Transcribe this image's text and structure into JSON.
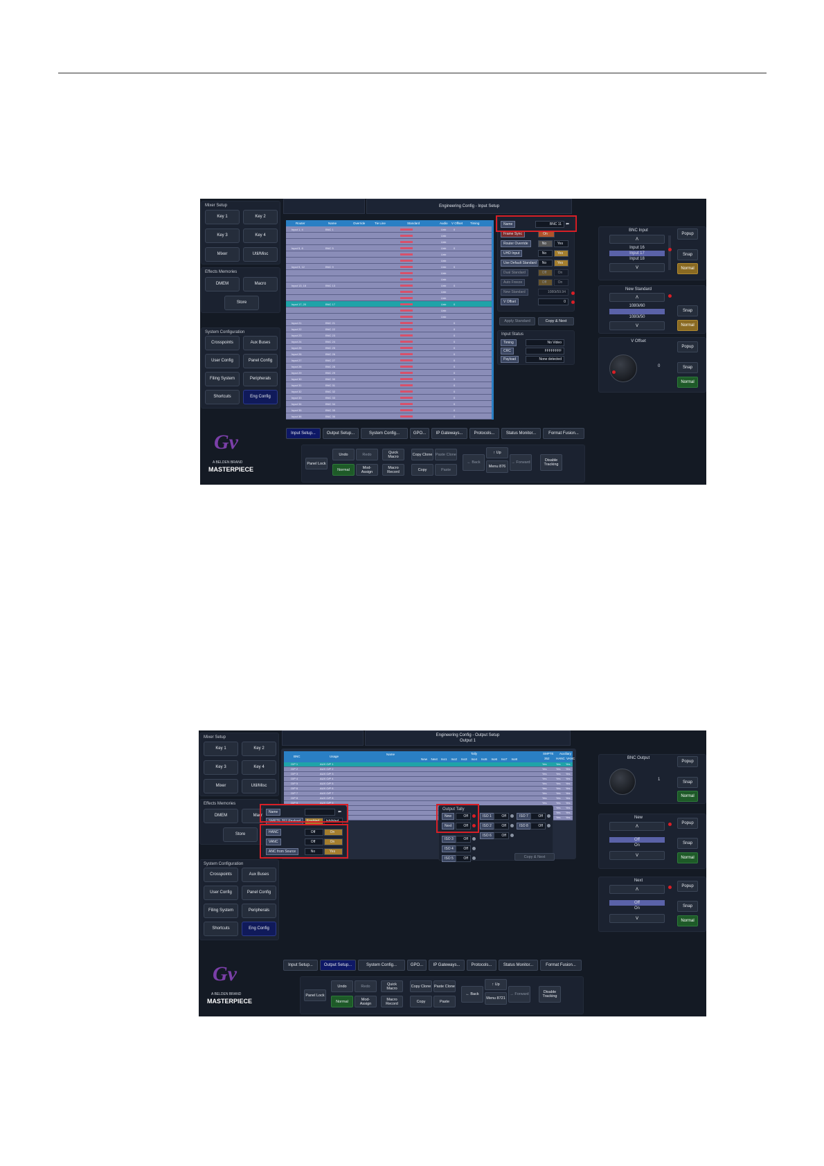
{
  "shot1": {
    "title": "Engineering Config - Input Setup",
    "mixer_setup": {
      "label": "Mixer Setup",
      "buttons": [
        "Key 1",
        "Key 2",
        "Key 3",
        "Key 4",
        "Mixer",
        "Util/Misc"
      ]
    },
    "effects_memories": {
      "label": "Effects Memories",
      "buttons": [
        "DMEM",
        "Macro",
        "Store"
      ]
    },
    "system_config": {
      "label": "System Configuration",
      "buttons": [
        "Crosspoints",
        "Aux Buses",
        "User Config",
        "Panel Config",
        "Filing System",
        "Peripherals",
        "Shortcuts",
        "Eng Config"
      ]
    },
    "brand": {
      "sub": "A BELDEN BRAND",
      "product": "MASTERPIECE"
    },
    "table_headers": [
      "Router",
      "Name",
      "Override",
      "Tie Line",
      "Standard",
      "Audio",
      "V Offset",
      "Timing"
    ],
    "rows": [
      {
        "router": "Input 1, 4",
        "name": "BNC 1",
        "std": "",
        "audio": "Unb",
        "off": "0"
      },
      {
        "router": "",
        "name": "",
        "std": "",
        "audio": "Unb",
        "off": ""
      },
      {
        "router": "",
        "name": "",
        "std": "",
        "audio": "Unb",
        "off": ""
      },
      {
        "router": "Input 5, 8",
        "name": "BNC 5",
        "std": "",
        "audio": "Unb",
        "off": "0"
      },
      {
        "router": "",
        "name": "",
        "std": "",
        "audio": "Unb",
        "off": ""
      },
      {
        "router": "",
        "name": "",
        "std": "",
        "audio": "Unb",
        "off": ""
      },
      {
        "router": "Input 9, 12",
        "name": "BNC 9",
        "std": "",
        "audio": "Unb",
        "off": "0"
      },
      {
        "router": "",
        "name": "",
        "std": "",
        "audio": "Unb",
        "off": ""
      },
      {
        "router": "",
        "name": "",
        "std": "",
        "audio": "Unb",
        "off": ""
      },
      {
        "router": "Input 13, 16",
        "name": "BNC 13",
        "std": "",
        "audio": "Unb",
        "off": "0"
      },
      {
        "router": "",
        "name": "",
        "std": "",
        "audio": "Unb",
        "off": ""
      },
      {
        "router": "",
        "name": "",
        "std": "",
        "audio": "Unb",
        "off": ""
      },
      {
        "router": "Input 17, 20",
        "name": "BNC 17",
        "std": "",
        "audio": "Unb",
        "off": "0"
      },
      {
        "router": "",
        "name": "",
        "std": "",
        "audio": "Unb",
        "off": ""
      },
      {
        "router": "",
        "name": "",
        "std": "",
        "audio": "Unb",
        "off": ""
      },
      {
        "router": "Input 21",
        "name": "BNC 21",
        "std": "",
        "audio": "",
        "off": "0"
      },
      {
        "router": "Input 22",
        "name": "BNC 22",
        "std": "",
        "audio": "",
        "off": "0"
      },
      {
        "router": "Input 23",
        "name": "BNC 23",
        "std": "",
        "audio": "",
        "off": "0"
      },
      {
        "router": "Input 24",
        "name": "BNC 24",
        "std": "",
        "audio": "",
        "off": "0"
      },
      {
        "router": "Input 25",
        "name": "BNC 25",
        "std": "",
        "audio": "",
        "off": "0"
      },
      {
        "router": "Input 26",
        "name": "BNC 26",
        "std": "",
        "audio": "",
        "off": "0"
      },
      {
        "router": "Input 27",
        "name": "BNC 27",
        "std": "",
        "audio": "",
        "off": "0"
      },
      {
        "router": "Input 28",
        "name": "BNC 28",
        "std": "",
        "audio": "",
        "off": "0"
      },
      {
        "router": "Input 29",
        "name": "BNC 29",
        "std": "",
        "audio": "",
        "off": "0"
      },
      {
        "router": "Input 30",
        "name": "BNC 30",
        "std": "",
        "audio": "",
        "off": "0"
      },
      {
        "router": "Input 31",
        "name": "BNC 31",
        "std": "",
        "audio": "",
        "off": "0"
      },
      {
        "router": "Input 32",
        "name": "BNC 32",
        "std": "",
        "audio": "",
        "off": "0"
      },
      {
        "router": "Input 33",
        "name": "BNC 33",
        "std": "",
        "audio": "",
        "off": "0"
      },
      {
        "router": "Input 34",
        "name": "BNC 34",
        "std": "",
        "audio": "",
        "off": "0"
      },
      {
        "router": "Input 35",
        "name": "BNC 35",
        "std": "",
        "audio": "",
        "off": "0"
      },
      {
        "router": "Input 36",
        "name": "BNC 36",
        "std": "",
        "audio": "",
        "off": "0"
      }
    ],
    "settings": {
      "name_label": "Name",
      "name_value": "BNC 11",
      "frame_sync": "Frame Sync",
      "frame_sync_val": "On",
      "router_override": "Router Override",
      "no": "No",
      "yes": "Yes",
      "uhd_input": "UHD Input",
      "use_default_std": "Use Default Standard",
      "dual_standard": "Dual Standard",
      "auto_freeze": "Auto Freeze",
      "off": "Off",
      "on": "On",
      "new_standard_label": "New Standard",
      "new_standard_val": "1080i/59.94",
      "v_offset_label": "V Offset",
      "v_offset_val": "0",
      "apply_standard": "Apply Standard",
      "copy_next": "Copy & Next"
    },
    "input_status": {
      "label": "Input Status",
      "timing": "Timing",
      "timing_val": "No Video",
      "crc": "CRC",
      "crc_val": "FFFFFFFF",
      "payload": "Payload",
      "payload_val": "None detected"
    },
    "right": {
      "bnc_input": "BNC Input",
      "inputs": [
        "Input 16",
        "Input 17",
        "Input 18"
      ],
      "new_standard": "New Standard",
      "standards": [
        "1080i/60",
        "1080i/59.94",
        "1080i/50"
      ],
      "v_offset": "V Offset",
      "v_offset_val": "0",
      "popup": "Popup",
      "snap": "Snap",
      "normal": "Normal"
    },
    "tabs": [
      "Input Setup...",
      "Output Setup...",
      "System Config...",
      "GPO...",
      "IP Gateways...",
      "Protocols...",
      "Status Monitor...",
      "Format Fusion..."
    ],
    "toolbar": {
      "panel_lock": "Panel Lock",
      "undo": "Undo",
      "redo": "Redo",
      "normal": "Normal",
      "quick_macro": "Quick Macro",
      "mod_assign": "Mod- Assign",
      "macro_record": "Macro Record",
      "copy_clone": "Copy Clone",
      "paste_clone": "Paste Clone",
      "copy": "Copy",
      "paste": "Paste",
      "back": "Back",
      "up": "Up",
      "menu": "Menu 876",
      "forward": "Forward",
      "disable_tracking": "Disable Tracking"
    }
  },
  "shot2": {
    "title": "Engineering Config - Output Setup",
    "subtitle": "Output 1",
    "headers": {
      "bnc": "BNC",
      "usage": "Usage",
      "name": "Name",
      "tally": "Tally",
      "tally_cols": [
        "New",
        "Next",
        "Iso1",
        "Iso2",
        "Iso3",
        "Iso4",
        "Iso5",
        "Iso6",
        "Iso7",
        "Iso8"
      ],
      "smpte": "SMPTE",
      "smpte_sub": "352",
      "aux": "Auxiliary",
      "hanc": "HANC",
      "vanc": "VANC"
    },
    "rows": [
      {
        "bnc": "O/P 1",
        "usage": "AUX O/P 1",
        "s": "Yes",
        "h": "Yes",
        "v": "Yes"
      },
      {
        "bnc": "O/P 2",
        "usage": "AUX O/P 2",
        "s": "Yes",
        "h": "Yes",
        "v": "Yes"
      },
      {
        "bnc": "O/P 3",
        "usage": "AUX O/P 3",
        "s": "Yes",
        "h": "Yes",
        "v": "Yes"
      },
      {
        "bnc": "O/P 4",
        "usage": "AUX O/P 4",
        "s": "Yes",
        "h": "Yes",
        "v": "Yes"
      },
      {
        "bnc": "O/P 5",
        "usage": "AUX O/P 5",
        "s": "Yes",
        "h": "Yes",
        "v": "Yes"
      },
      {
        "bnc": "O/P 6",
        "usage": "AUX O/P 6",
        "s": "Yes",
        "h": "Yes",
        "v": "Yes"
      },
      {
        "bnc": "O/P 7",
        "usage": "AUX O/P 7",
        "s": "Yes",
        "h": "Yes",
        "v": "Yes"
      },
      {
        "bnc": "O/P 8",
        "usage": "AUX O/P 8",
        "s": "Yes",
        "h": "Yes",
        "v": "Yes"
      },
      {
        "bnc": "O/P 9",
        "usage": "AUX O/P 9",
        "s": "Yes",
        "h": "Yes",
        "v": "Yes"
      },
      {
        "bnc": "O/P 10",
        "usage": "AUX O/P 10",
        "s": "Yes",
        "h": "Yes",
        "v": "Yes"
      },
      {
        "bnc": "O/P 11",
        "usage": "AUX O/P 11",
        "s": "Yes",
        "h": "Yes",
        "v": "Yes"
      },
      {
        "bnc": "O/P 12",
        "usage": "AUX O/P 12",
        "s": "Yes",
        "h": "Yes",
        "v": "Yes"
      }
    ],
    "settings": {
      "name": "Name",
      "smpte": "SMPTE 352 Payload",
      "enabled": "Enabled",
      "inhibited": "Inhibited",
      "hanc": "HANC",
      "vanc": "VANC",
      "anc": "ANC from Source",
      "off": "Off",
      "on": "On",
      "no": "No",
      "yes": "Yes"
    },
    "tally": {
      "label": "Output Tally",
      "items": [
        {
          "k": "New",
          "v": "Off"
        },
        {
          "k": "Next",
          "v": "Off"
        },
        {
          "k": "ISO 1",
          "v": "Off"
        },
        {
          "k": "ISO 2",
          "v": "Off"
        },
        {
          "k": "ISO 3",
          "v": "Off"
        },
        {
          "k": "ISO 4",
          "v": "Off"
        },
        {
          "k": "ISO 5",
          "v": "Off"
        },
        {
          "k": "ISO 6",
          "v": "Off"
        },
        {
          "k": "ISO 7",
          "v": "Off"
        },
        {
          "k": "ISO 8",
          "v": "Off"
        }
      ],
      "copy_next": "Copy & Next"
    },
    "right": {
      "bnc_output": "BNC Output",
      "bnc_val": "1",
      "new": "New",
      "next": "Next",
      "off": "Off",
      "on": "On",
      "popup": "Popup",
      "snap": "Snap",
      "normal": "Normal"
    },
    "menu": "Menu 8721"
  }
}
